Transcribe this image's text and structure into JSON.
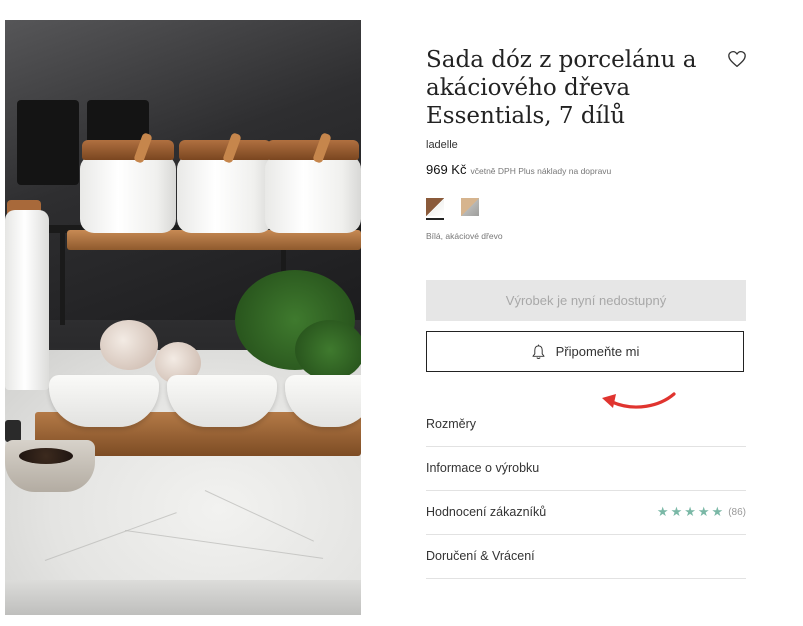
{
  "product": {
    "title": "Sada dóz z porcelánu a akáciového dřeva Essentials, 7 dílů",
    "brand": "ladelle",
    "price": "969 Kč",
    "price_note": "včetně DPH Plus náklady na dopravu",
    "color_name": "Bílá, akáciové dřevo",
    "image_icon": "product-photo"
  },
  "swatches": [
    {
      "name": "swatch-white-wood",
      "selected": true
    },
    {
      "name": "swatch-beige-grey",
      "selected": false
    }
  ],
  "buttons": {
    "unavailable_label": "Výrobek je nyní nedostupný",
    "remind_label": "Připomeňte mi"
  },
  "accordion": {
    "dimensions": "Rozměry",
    "product_info": "Informace o výrobku",
    "reviews": "Hodnocení zákazníků",
    "delivery": "Doručení & Vrácení"
  },
  "rating": {
    "stars": 5,
    "count": "(86)",
    "star_glyph": "★"
  },
  "colors": {
    "star": "#7ab8a6",
    "arrow": "#e0342f",
    "unavailable_bg": "#e6e6e6"
  },
  "icons": {
    "wishlist": "heart-icon",
    "remind": "bell-icon",
    "annotation": "red-arrow-icon"
  }
}
